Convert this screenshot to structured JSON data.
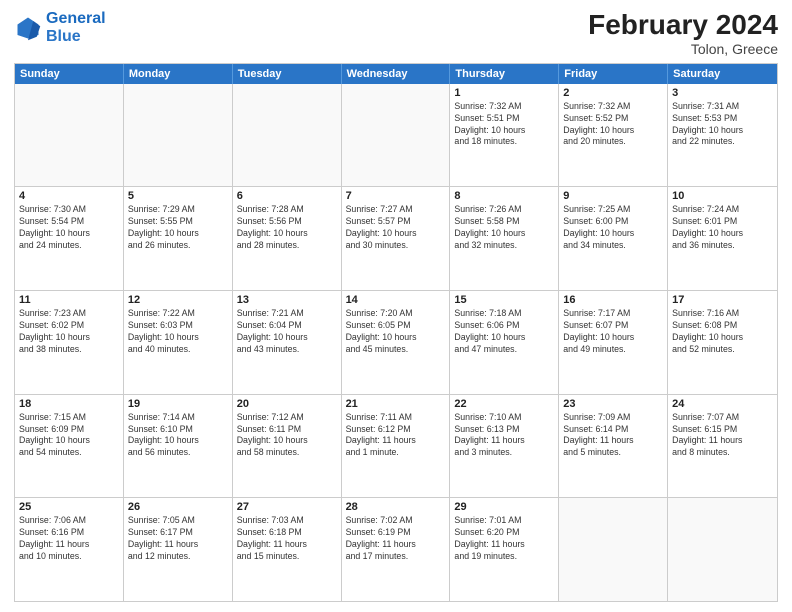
{
  "header": {
    "logo_general": "General",
    "logo_blue": "Blue",
    "title": "February 2024",
    "subtitle": "Tolon, Greece"
  },
  "days_of_week": [
    "Sunday",
    "Monday",
    "Tuesday",
    "Wednesday",
    "Thursday",
    "Friday",
    "Saturday"
  ],
  "weeks": [
    [
      {
        "day": "",
        "info": ""
      },
      {
        "day": "",
        "info": ""
      },
      {
        "day": "",
        "info": ""
      },
      {
        "day": "",
        "info": ""
      },
      {
        "day": "1",
        "info": "Sunrise: 7:32 AM\nSunset: 5:51 PM\nDaylight: 10 hours\nand 18 minutes."
      },
      {
        "day": "2",
        "info": "Sunrise: 7:32 AM\nSunset: 5:52 PM\nDaylight: 10 hours\nand 20 minutes."
      },
      {
        "day": "3",
        "info": "Sunrise: 7:31 AM\nSunset: 5:53 PM\nDaylight: 10 hours\nand 22 minutes."
      }
    ],
    [
      {
        "day": "4",
        "info": "Sunrise: 7:30 AM\nSunset: 5:54 PM\nDaylight: 10 hours\nand 24 minutes."
      },
      {
        "day": "5",
        "info": "Sunrise: 7:29 AM\nSunset: 5:55 PM\nDaylight: 10 hours\nand 26 minutes."
      },
      {
        "day": "6",
        "info": "Sunrise: 7:28 AM\nSunset: 5:56 PM\nDaylight: 10 hours\nand 28 minutes."
      },
      {
        "day": "7",
        "info": "Sunrise: 7:27 AM\nSunset: 5:57 PM\nDaylight: 10 hours\nand 30 minutes."
      },
      {
        "day": "8",
        "info": "Sunrise: 7:26 AM\nSunset: 5:58 PM\nDaylight: 10 hours\nand 32 minutes."
      },
      {
        "day": "9",
        "info": "Sunrise: 7:25 AM\nSunset: 6:00 PM\nDaylight: 10 hours\nand 34 minutes."
      },
      {
        "day": "10",
        "info": "Sunrise: 7:24 AM\nSunset: 6:01 PM\nDaylight: 10 hours\nand 36 minutes."
      }
    ],
    [
      {
        "day": "11",
        "info": "Sunrise: 7:23 AM\nSunset: 6:02 PM\nDaylight: 10 hours\nand 38 minutes."
      },
      {
        "day": "12",
        "info": "Sunrise: 7:22 AM\nSunset: 6:03 PM\nDaylight: 10 hours\nand 40 minutes."
      },
      {
        "day": "13",
        "info": "Sunrise: 7:21 AM\nSunset: 6:04 PM\nDaylight: 10 hours\nand 43 minutes."
      },
      {
        "day": "14",
        "info": "Sunrise: 7:20 AM\nSunset: 6:05 PM\nDaylight: 10 hours\nand 45 minutes."
      },
      {
        "day": "15",
        "info": "Sunrise: 7:18 AM\nSunset: 6:06 PM\nDaylight: 10 hours\nand 47 minutes."
      },
      {
        "day": "16",
        "info": "Sunrise: 7:17 AM\nSunset: 6:07 PM\nDaylight: 10 hours\nand 49 minutes."
      },
      {
        "day": "17",
        "info": "Sunrise: 7:16 AM\nSunset: 6:08 PM\nDaylight: 10 hours\nand 52 minutes."
      }
    ],
    [
      {
        "day": "18",
        "info": "Sunrise: 7:15 AM\nSunset: 6:09 PM\nDaylight: 10 hours\nand 54 minutes."
      },
      {
        "day": "19",
        "info": "Sunrise: 7:14 AM\nSunset: 6:10 PM\nDaylight: 10 hours\nand 56 minutes."
      },
      {
        "day": "20",
        "info": "Sunrise: 7:12 AM\nSunset: 6:11 PM\nDaylight: 10 hours\nand 58 minutes."
      },
      {
        "day": "21",
        "info": "Sunrise: 7:11 AM\nSunset: 6:12 PM\nDaylight: 11 hours\nand 1 minute."
      },
      {
        "day": "22",
        "info": "Sunrise: 7:10 AM\nSunset: 6:13 PM\nDaylight: 11 hours\nand 3 minutes."
      },
      {
        "day": "23",
        "info": "Sunrise: 7:09 AM\nSunset: 6:14 PM\nDaylight: 11 hours\nand 5 minutes."
      },
      {
        "day": "24",
        "info": "Sunrise: 7:07 AM\nSunset: 6:15 PM\nDaylight: 11 hours\nand 8 minutes."
      }
    ],
    [
      {
        "day": "25",
        "info": "Sunrise: 7:06 AM\nSunset: 6:16 PM\nDaylight: 11 hours\nand 10 minutes."
      },
      {
        "day": "26",
        "info": "Sunrise: 7:05 AM\nSunset: 6:17 PM\nDaylight: 11 hours\nand 12 minutes."
      },
      {
        "day": "27",
        "info": "Sunrise: 7:03 AM\nSunset: 6:18 PM\nDaylight: 11 hours\nand 15 minutes."
      },
      {
        "day": "28",
        "info": "Sunrise: 7:02 AM\nSunset: 6:19 PM\nDaylight: 11 hours\nand 17 minutes."
      },
      {
        "day": "29",
        "info": "Sunrise: 7:01 AM\nSunset: 6:20 PM\nDaylight: 11 hours\nand 19 minutes."
      },
      {
        "day": "",
        "info": ""
      },
      {
        "day": "",
        "info": ""
      }
    ]
  ]
}
